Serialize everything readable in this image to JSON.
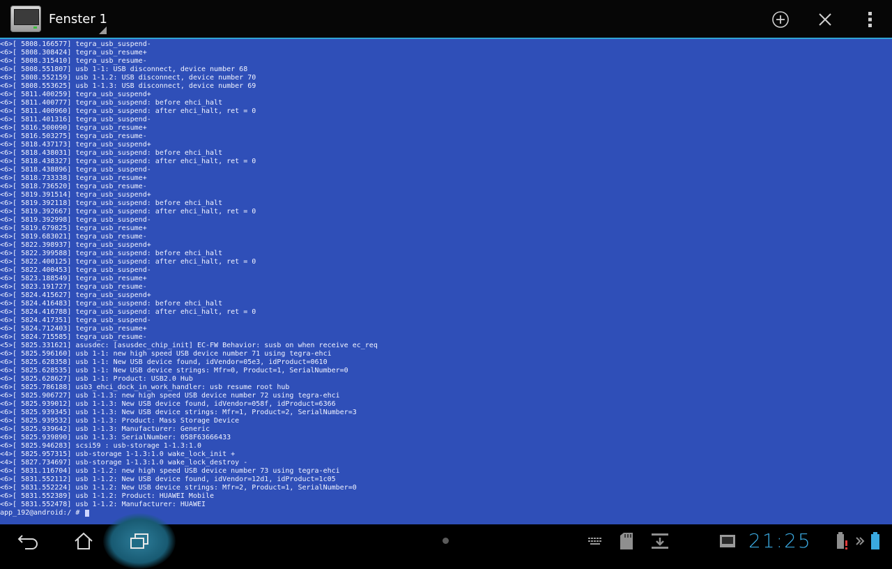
{
  "window": {
    "title": "Fenster 1",
    "app_icon": "terminal-app-icon",
    "actions": [
      {
        "name": "new-window-button",
        "icon": "plus-circle-icon"
      },
      {
        "name": "close-window-button",
        "icon": "close-icon"
      },
      {
        "name": "overflow-menu-button",
        "icon": "more-vert-icon"
      }
    ]
  },
  "colors": {
    "terminal_bg": "#2f4fb8",
    "terminal_fg": "#f2f4ff",
    "accent": "#2fa4d6",
    "clock": "#3aa9e0"
  },
  "terminal": {
    "lines": [
      "<6>[ 5808.166577] tegra_usb_suspend-",
      "<6>[ 5808.308424] tegra_usb_resume+",
      "<6>[ 5808.315410] tegra_usb_resume-",
      "<6>[ 5808.551807] usb 1-1: USB disconnect, device number 68",
      "<6>[ 5808.552159] usb 1-1.2: USB disconnect, device number 70",
      "<6>[ 5808.553625] usb 1-1.3: USB disconnect, device number 69",
      "<6>[ 5811.400259] tegra_usb_suspend+",
      "<6>[ 5811.400777] tegra_usb_suspend: before ehci_halt",
      "<6>[ 5811.400960] tegra_usb_suspend: after ehci_halt, ret = 0",
      "<6>[ 5811.401316] tegra_usb_suspend-",
      "<6>[ 5816.500090] tegra_usb_resume+",
      "<6>[ 5816.503275] tegra_usb_resume-",
      "<6>[ 5818.437173] tegra_usb_suspend+",
      "<6>[ 5818.438031] tegra_usb_suspend: before ehci_halt",
      "<6>[ 5818.438327] tegra_usb_suspend: after ehci_halt, ret = 0",
      "<6>[ 5818.438896] tegra_usb_suspend-",
      "<6>[ 5818.733338] tegra_usb_resume+",
      "<6>[ 5818.736520] tegra_usb_resume-",
      "<6>[ 5819.391514] tegra_usb_suspend+",
      "<6>[ 5819.392118] tegra_usb_suspend: before ehci_halt",
      "<6>[ 5819.392667] tegra_usb_suspend: after ehci_halt, ret = 0",
      "<6>[ 5819.392998] tegra_usb_suspend-",
      "<6>[ 5819.679825] tegra_usb_resume+",
      "<6>[ 5819.683021] tegra_usb_resume-",
      "<6>[ 5822.398937] tegra_usb_suspend+",
      "<6>[ 5822.399588] tegra_usb_suspend: before ehci_halt",
      "<6>[ 5822.400125] tegra_usb_suspend: after ehci_halt, ret = 0",
      "<6>[ 5822.400453] tegra_usb_suspend-",
      "<6>[ 5823.188549] tegra_usb_resume+",
      "<6>[ 5823.191727] tegra_usb_resume-",
      "<6>[ 5824.415627] tegra_usb_suspend+",
      "<6>[ 5824.416483] tegra_usb_suspend: before ehci_halt",
      "<6>[ 5824.416788] tegra_usb_suspend: after ehci_halt, ret = 0",
      "<6>[ 5824.417351] tegra_usb_suspend-",
      "<6>[ 5824.712403] tegra_usb_resume+",
      "<6>[ 5824.715585] tegra_usb_resume-",
      "<5>[ 5825.331621] asusdec: [asusdec_chip_init] EC-FW Behavior: susb on when receive ec_req",
      "<6>[ 5825.596160] usb 1-1: new high speed USB device number 71 using tegra-ehci",
      "<6>[ 5825.628358] usb 1-1: New USB device found, idVendor=05e3, idProduct=0610",
      "<6>[ 5825.628535] usb 1-1: New USB device strings: Mfr=0, Product=1, SerialNumber=0",
      "<6>[ 5825.628627] usb 1-1: Product: USB2.0 Hub",
      "<6>[ 5825.786188] usb3_ehci_dock_in_work_handler: usb resume root hub",
      "<6>[ 5825.906727] usb 1-1.3: new high speed USB device number 72 using tegra-ehci",
      "<6>[ 5825.939012] usb 1-1.3: New USB device found, idVendor=058f, idProduct=6366",
      "<6>[ 5825.939345] usb 1-1.3: New USB device strings: Mfr=1, Product=2, SerialNumber=3",
      "<6>[ 5825.939532] usb 1-1.3: Product: Mass Storage Device",
      "<6>[ 5825.939642] usb 1-1.3: Manufacturer: Generic",
      "<6>[ 5825.939890] usb 1-1.3: SerialNumber: 058F63666433",
      "<6>[ 5825.946283] scsi59 : usb-storage 1-1.3:1.0",
      "<4>[ 5825.957315] usb-storage 1-1.3:1.0 wake_lock_init +",
      "<4>[ 5827.734697] usb-storage 1-1.3:1.0 wake_lock_destroy -",
      "<6>[ 5831.116704] usb 1-1.2: new high speed USB device number 73 using tegra-ehci",
      "<6>[ 5831.552112] usb 1-1.2: New USB device found, idVendor=12d1, idProduct=1c05",
      "<6>[ 5831.552224] usb 1-1.2: New USB device strings: Mfr=2, Product=1, SerialNumber=0",
      "<6>[ 5831.552389] usb 1-1.2: Product: HUAWEI Mobile",
      "<6>[ 5831.552478] usb 1-1.2: Manufacturer: HUAWEI"
    ],
    "prompt": "app_192@android:/ # "
  },
  "system_bar": {
    "nav": [
      {
        "name": "back-button",
        "icon": "back-arrow-icon"
      },
      {
        "name": "home-button",
        "icon": "home-icon"
      },
      {
        "name": "recents-button",
        "icon": "recent-apps-icon"
      }
    ],
    "notifications": [
      "keyboard-icon",
      "sd-card-icon",
      "download-icon",
      "terminal-notification-icon"
    ],
    "clock": "21:25",
    "status": [
      "battery-warning-icon",
      "chevrons-icon",
      "battery-icon"
    ]
  }
}
